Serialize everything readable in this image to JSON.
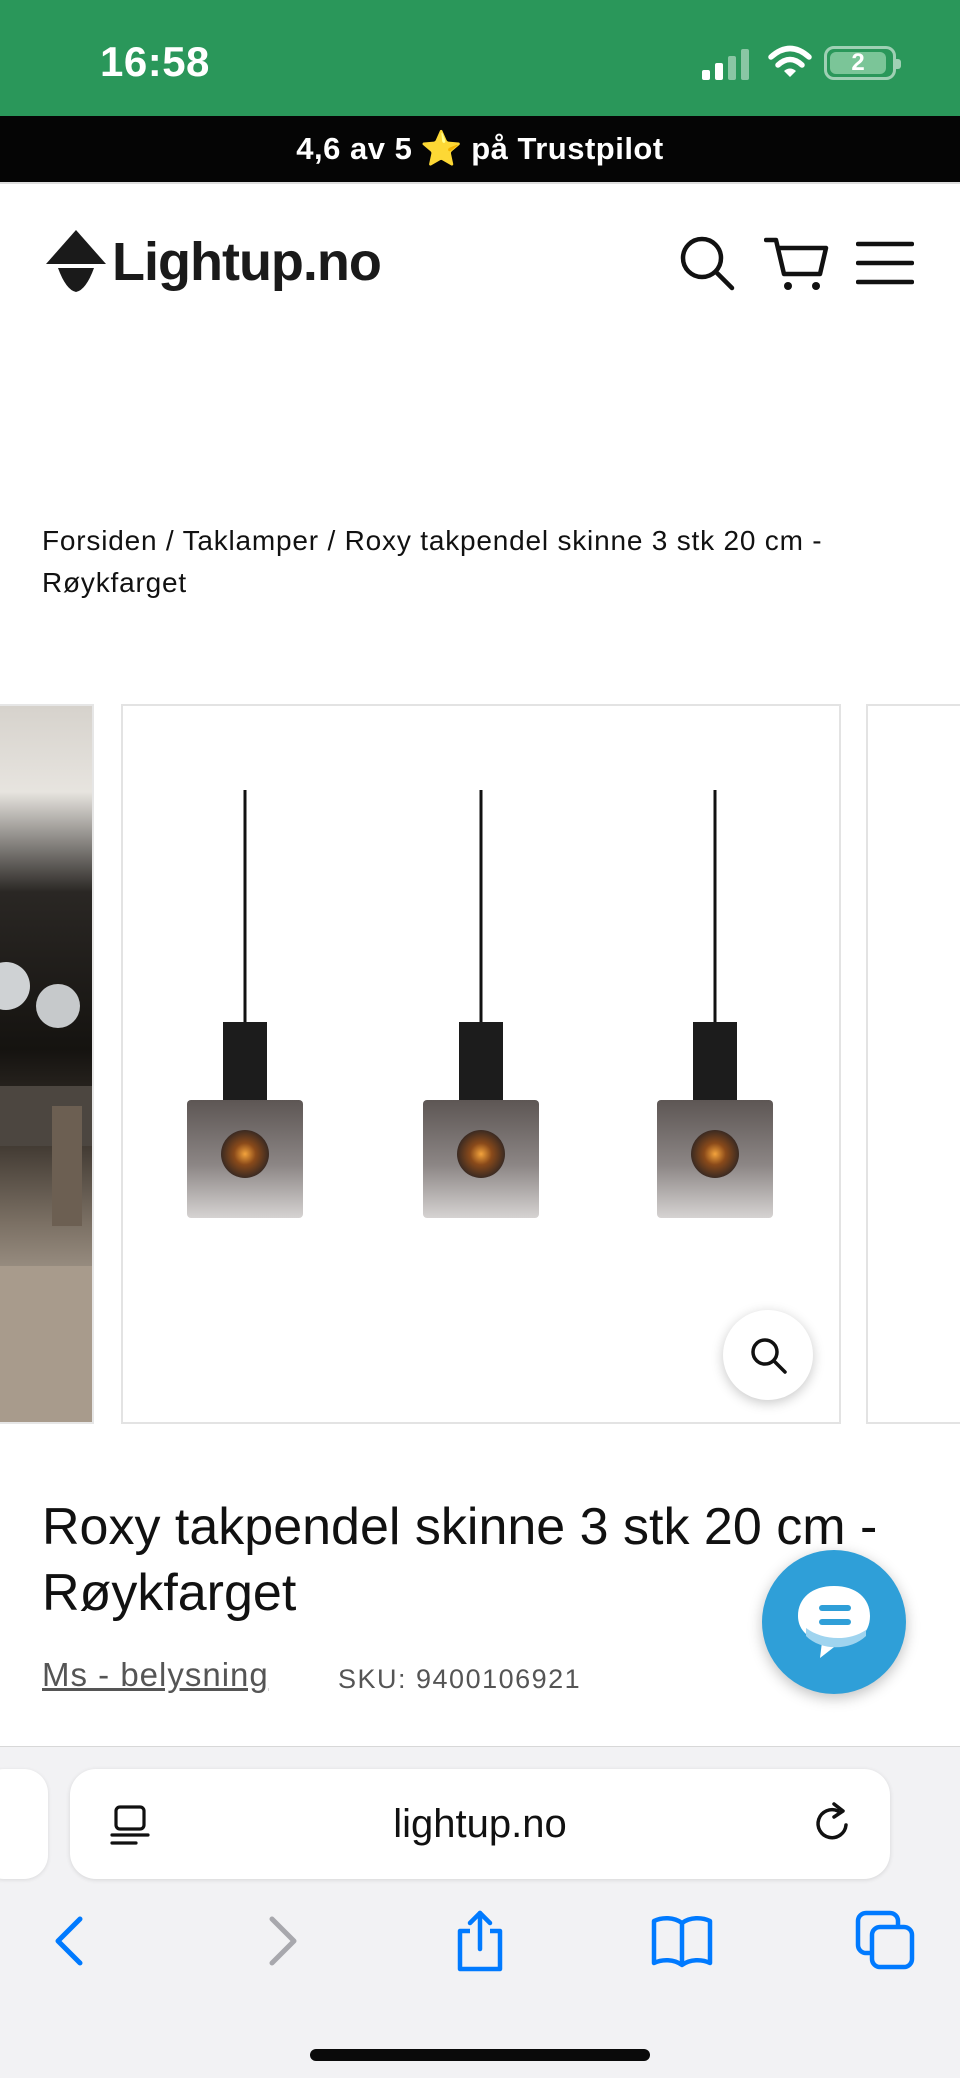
{
  "status_bar": {
    "time": "16:58",
    "battery_label": "2",
    "icons": [
      "cellular-signal-icon",
      "wifi-icon",
      "battery-icon"
    ]
  },
  "announcement": {
    "before_star": "4,6 av 5",
    "star": "⭐",
    "after_star": "på Trustpilot"
  },
  "header": {
    "logo_text": "Lightup.no",
    "icons": [
      "search-icon",
      "cart-icon",
      "menu-icon"
    ]
  },
  "breadcrumb": {
    "text": "Forsiden / Taklamper / Roxy takpendel skinne 3 stk 20 cm - Røykfarget"
  },
  "gallery": {
    "main_image": "three-smoked-glass-pendant-lamps",
    "zoom_icon": "zoom-search-icon"
  },
  "product": {
    "title": "Roxy takpendel skinne 3 stk 20 cm - Røykfarget",
    "vendor": "Ms - belysning",
    "sku": "SKU: 9400106921"
  },
  "chat": {
    "icon": "chat-bubble-icon",
    "color": "#2f9fd8"
  },
  "browser": {
    "url": "lightup.no",
    "toolbar_icons": [
      "back-icon",
      "forward-icon",
      "share-icon",
      "bookmarks-icon",
      "tabs-icon"
    ],
    "accent": "#007aff"
  },
  "colors": {
    "status_bar": "#2a975a",
    "announcement_bg": "#050505"
  }
}
